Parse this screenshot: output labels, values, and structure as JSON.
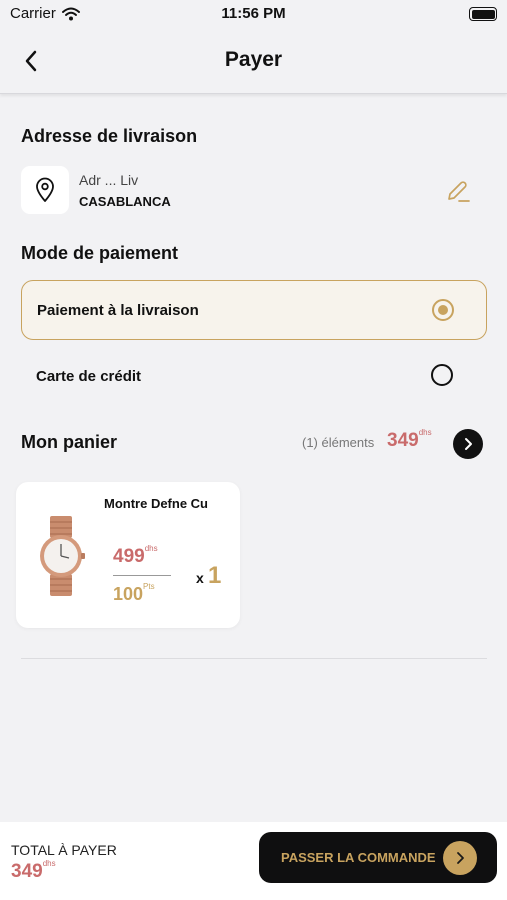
{
  "status_bar": {
    "carrier": "Carrier",
    "time": "11:56 PM",
    "icons": [
      "wifi-icon",
      "battery-icon"
    ]
  },
  "nav": {
    "title": "Payer",
    "back_icon": "chevron-left-icon"
  },
  "address": {
    "section_title": "Adresse de livraison",
    "line1": "Adr ... Liv",
    "city": "CASABLANCA",
    "icons": [
      "location-pin-icon",
      "edit-pencil-icon"
    ]
  },
  "payment": {
    "section_title": "Mode de paiement",
    "options": [
      {
        "label": "Paiement à la livraison",
        "selected": true
      },
      {
        "label": "Carte de crédit",
        "selected": false
      }
    ]
  },
  "cart": {
    "section_title": "Mon panier",
    "count_text": "(1) éléments",
    "total": "349",
    "currency": "dhs",
    "items": [
      {
        "name": "Montre Defne Cu",
        "price": "499",
        "currency": "dhs",
        "points": "100",
        "points_unit": "Pts",
        "qty_prefix": "x",
        "qty": "1"
      }
    ]
  },
  "footer": {
    "total_label": "TOTAL À PAYER",
    "total_value": "349",
    "currency": "dhs",
    "order_button": "PASSER LA COMMANDE"
  },
  "colors": {
    "accent_gold": "#c8a35f",
    "price_red": "#c96b6b",
    "background": "#f2f2f4"
  }
}
